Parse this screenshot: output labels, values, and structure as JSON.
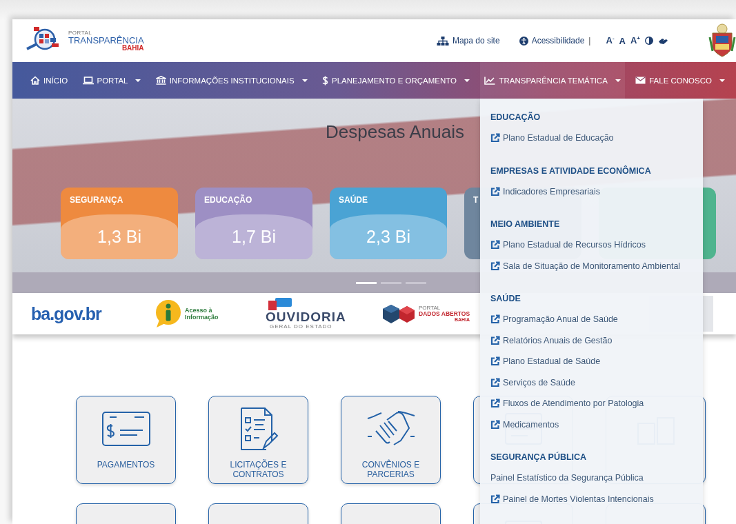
{
  "header": {
    "logo": {
      "small": "PORTAL",
      "title": "TRANSPARÊNCIA",
      "region": "BAHIA"
    },
    "links": [
      {
        "label": "Mapa do site",
        "kind": "sitemap"
      },
      {
        "label": "Acessibilidade",
        "kind": "accessibility"
      }
    ],
    "separator": "|",
    "font_buttons": [
      "A$^{-}$",
      "A",
      "A$^{+}$"
    ]
  },
  "nav": [
    {
      "label": "INÍCIO",
      "kind": "home",
      "has_menu": false,
      "expanded": false
    },
    {
      "label": "PORTAL",
      "kind": "laptop",
      "has_menu": true,
      "expanded": false
    },
    {
      "label": "INFORMAÇÕES INSTITUCIONAIS",
      "kind": "bank",
      "has_menu": true,
      "expanded": false
    },
    {
      "label": "PLANEJAMENTO E ORÇAMENTO",
      "kind": "dollar",
      "has_menu": true,
      "expanded": false
    },
    {
      "label": "TRANSPARÊNCIA TEMÁTICA",
      "kind": "chart",
      "has_menu": true,
      "expanded": true,
      "menu": [
        {
          "heading": "EDUCAÇÃO",
          "items": [
            {
              "label": "Plano Estadual de Educação",
              "external": true
            }
          ]
        },
        {
          "heading": "EMPRESAS E ATIVIDADE ECONÔMICA",
          "items": [
            {
              "label": "Indicadores Empresariais",
              "external": true
            }
          ]
        },
        {
          "heading": "MEIO AMBIENTE",
          "items": [
            {
              "label": "Plano Estadual de Recursos Hídricos",
              "external": true
            },
            {
              "label": "Sala de Situação de Monitoramento Ambiental",
              "external": true
            }
          ]
        },
        {
          "heading": "SAÚDE",
          "items": [
            {
              "label": "Programação Anual de Saúde",
              "external": true
            },
            {
              "label": "Relatórios Anuais de Gestão",
              "external": true
            },
            {
              "label": "Plano Estadual de Saúde",
              "external": true
            },
            {
              "label": "Serviços de Saúde",
              "external": true
            },
            {
              "label": "Fluxos de Atendimento por Patologia",
              "external": true
            },
            {
              "label": "Medicamentos",
              "external": true
            }
          ]
        },
        {
          "heading": "SEGURANÇA PÚBLICA",
          "items": [
            {
              "label": "Painel Estatístico da Segurança Pública",
              "external": false
            },
            {
              "label": "Painel de Mortes Violentas Intencionais",
              "external": true
            }
          ]
        }
      ]
    },
    {
      "label": "FALE CONOSCO",
      "kind": "envelope",
      "has_menu": true,
      "expanded": false
    }
  ],
  "hero": {
    "title": "Despesas Anuais",
    "cards": [
      {
        "label": "SEGURANÇA",
        "value": "1,3 Bi",
        "color": "#ee8a3f"
      },
      {
        "label": "EDUCAÇÃO",
        "value": "1,7 Bi",
        "color": "#9d8fc4"
      },
      {
        "label": "SAÚDE",
        "value": "2,3 Bi",
        "color": "#4aa3d4"
      },
      {
        "label": "T",
        "color": "#6f869e"
      },
      {
        "color": "#4fb48e"
      }
    ],
    "dots": [
      {
        "selected": true
      },
      {
        "selected": false
      },
      {
        "selected": false
      }
    ]
  },
  "partners": [
    {
      "kind": "bagov",
      "text": "ba.gov.br"
    },
    {
      "kind": "acesso",
      "text": "Acesso à Informação"
    },
    {
      "kind": "ouvidoria",
      "text": "OUVIDORIA",
      "subtitle": "GERAL DO ESTADO"
    },
    {
      "kind": "dados",
      "small": "PORTAL",
      "text": "DADOS ABERTOS",
      "subtitle": "BAHIA"
    },
    {
      "kind": "brasil"
    }
  ],
  "tiles": [
    {
      "kind": "check",
      "label": "PAGAMENTOS"
    },
    {
      "kind": "checklist",
      "label": "LICITAÇÕES E CONTRATOS"
    },
    {
      "kind": "handshake",
      "label": "CONVÊNIOS E PARCERIAS"
    },
    {
      "kind": "receipt"
    },
    {
      "kind": "coins"
    },
    {
      "kind": "globe"
    },
    {
      "kind": "notebook"
    },
    {
      "kind": "people"
    },
    {
      "kind": "receipt"
    },
    {
      "kind": "coins"
    }
  ]
}
